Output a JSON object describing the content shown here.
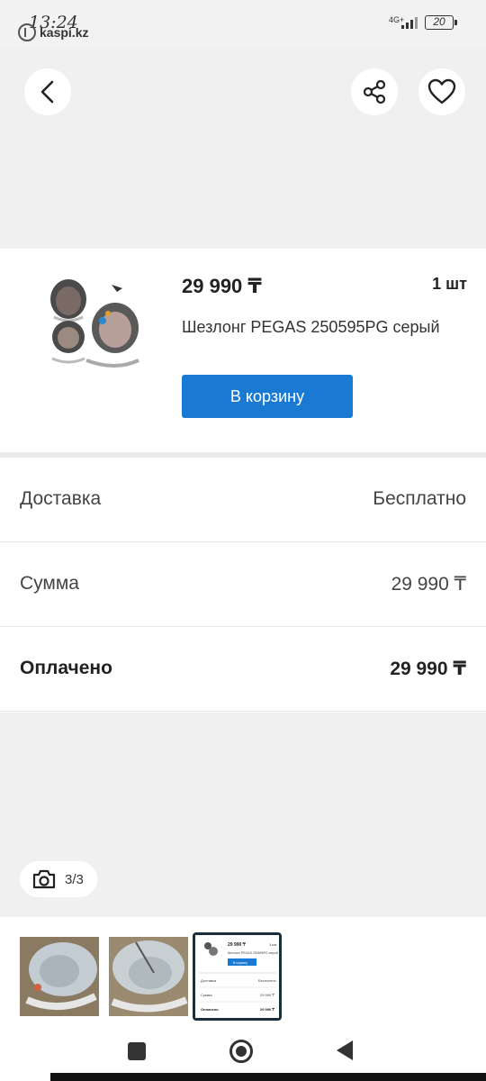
{
  "status_bar": {
    "time": "13:24",
    "brand": "kaspi.kz",
    "network": "4G+",
    "battery": "20"
  },
  "header": {
    "back_icon": "chevron-left-icon",
    "share_icon": "share-icon",
    "favorite_icon": "heart-icon"
  },
  "product": {
    "price": "29 990 ₸",
    "quantity": "1 шт",
    "title": "Шезлонг PEGAS 250595PG серый",
    "cart_button": "В корзину"
  },
  "summary": {
    "rows": [
      {
        "label": "Доставка",
        "value": "Бесплатно"
      },
      {
        "label": "Сумма",
        "value": "29 990 ₸"
      },
      {
        "label": "Оплачено",
        "value": "29 990 ₸"
      }
    ]
  },
  "gallery": {
    "counter": "3/3",
    "camera_icon": "camera-icon",
    "thumbnails": [
      "photo-1",
      "photo-2",
      "screenshot-3"
    ],
    "mini": {
      "price": "29 990 ₸",
      "qty": "1 шт",
      "title": "Шезлонг PEGAS 250595PG серый",
      "cart": "В корзину",
      "rows": [
        {
          "label": "Доставка",
          "value": "Бесплатно"
        },
        {
          "label": "Сумма",
          "value": "29 990 ₸"
        },
        {
          "label": "Оплачено",
          "value": "29 990 ₸"
        }
      ]
    }
  },
  "colors": {
    "accent": "#1a7ad3",
    "background": "#f0f0f0"
  }
}
